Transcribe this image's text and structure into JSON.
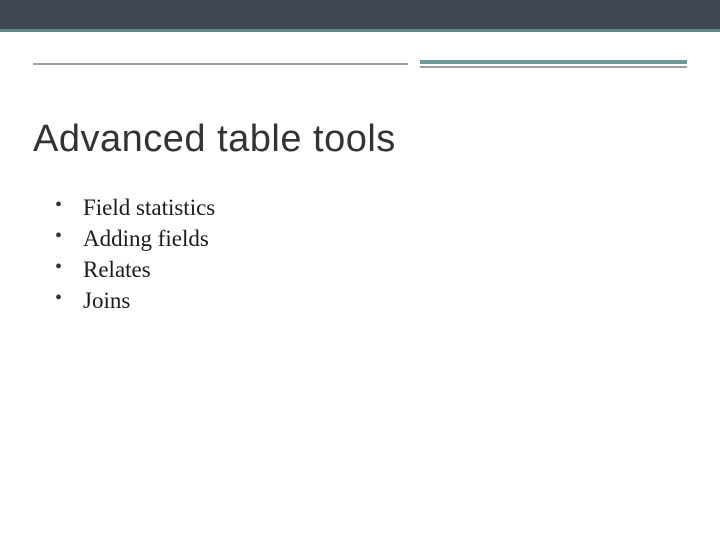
{
  "slide": {
    "title": "Advanced table tools",
    "bullets": [
      "Field statistics",
      "Adding fields",
      "Relates",
      "Joins"
    ]
  }
}
